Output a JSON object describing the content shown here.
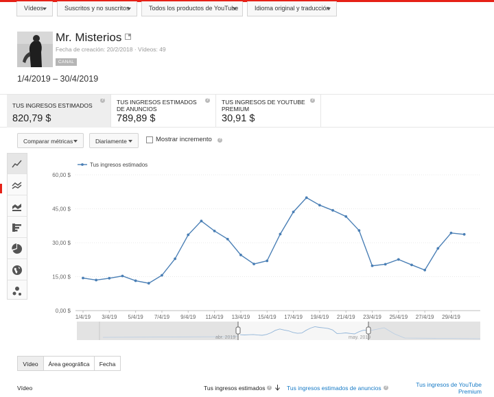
{
  "filters": [
    {
      "label": "Vídeos"
    },
    {
      "label": "Suscritos y no suscritos"
    },
    {
      "label": "Todos los productos de YouTube"
    },
    {
      "label": "Idioma original y traducción"
    }
  ],
  "channel": {
    "name": "Mr. Misterios",
    "meta": "Fecha de creación: 20/2/2018 · Vídeos: 49",
    "badge": "CANAL"
  },
  "date_range": "1/4/2019 – 30/4/2019",
  "metrics": [
    {
      "label": "Tus ingresos estimados",
      "value": "820,79 $"
    },
    {
      "label": "Tus ingresos estimados de anuncios",
      "value": "789,89 $"
    },
    {
      "label": "Tus ingresos de YouTube Premium",
      "value": "30,91 $"
    }
  ],
  "toolbar": {
    "compare": "Comparar métricas",
    "period": "Diariamente",
    "increment": "Mostrar incremento"
  },
  "sidebar_icons": [
    "line-chart-icon",
    "multi-line-icon",
    "area-chart-icon",
    "bar-chart-icon",
    "pie-chart-icon",
    "globe-icon",
    "bubble-chart-icon"
  ],
  "chart_data": {
    "type": "line",
    "legend": "Tus ingresos estimados",
    "y_ticks": [
      "60,00 $",
      "45,00 $",
      "30,00 $",
      "15,00 $",
      "0,00 $"
    ],
    "ylim": [
      0,
      60
    ],
    "x_tick_labels": [
      "1/4/19",
      "3/4/19",
      "5/4/19",
      "7/4/19",
      "9/4/19",
      "11/4/19",
      "13/4/19",
      "15/4/19",
      "17/4/19",
      "19/4/19",
      "21/4/19",
      "23/4/19",
      "25/4/19",
      "27/4/19",
      "29/4/19"
    ],
    "x": [
      "1/4/19",
      "2/4/19",
      "3/4/19",
      "4/4/19",
      "5/4/19",
      "6/4/19",
      "7/4/19",
      "8/4/19",
      "9/4/19",
      "10/4/19",
      "11/4/19",
      "12/4/19",
      "13/4/19",
      "14/4/19",
      "15/4/19",
      "16/4/19",
      "17/4/19",
      "18/4/19",
      "19/4/19",
      "20/4/19",
      "21/4/19",
      "22/4/19",
      "23/4/19",
      "24/4/19",
      "25/4/19",
      "26/4/19",
      "27/4/19",
      "28/4/19",
      "29/4/19",
      "30/4/19"
    ],
    "values": [
      14.4,
      13.5,
      14.3,
      15.3,
      13.2,
      12.1,
      15.6,
      22.9,
      33.5,
      39.6,
      35.2,
      31.6,
      24.6,
      20.6,
      22.0,
      33.8,
      43.6,
      49.9,
      46.6,
      44.3,
      41.6,
      35.4,
      19.8,
      20.5,
      22.6,
      20.2,
      17.9,
      27.5,
      34.3,
      33.7
    ],
    "overview_labels": [
      "abr. 2019",
      "may. 2019"
    ]
  },
  "tabs": [
    {
      "label": "Vídeo"
    },
    {
      "label": "Área geográfica"
    },
    {
      "label": "Fecha"
    }
  ],
  "table": {
    "col_video": "Vídeo",
    "col_income": "Tus ingresos estimados",
    "col_ads": "Tus ingresos estimados de anuncios",
    "col_premium": "Tus ingresos de YouTube Premium"
  }
}
